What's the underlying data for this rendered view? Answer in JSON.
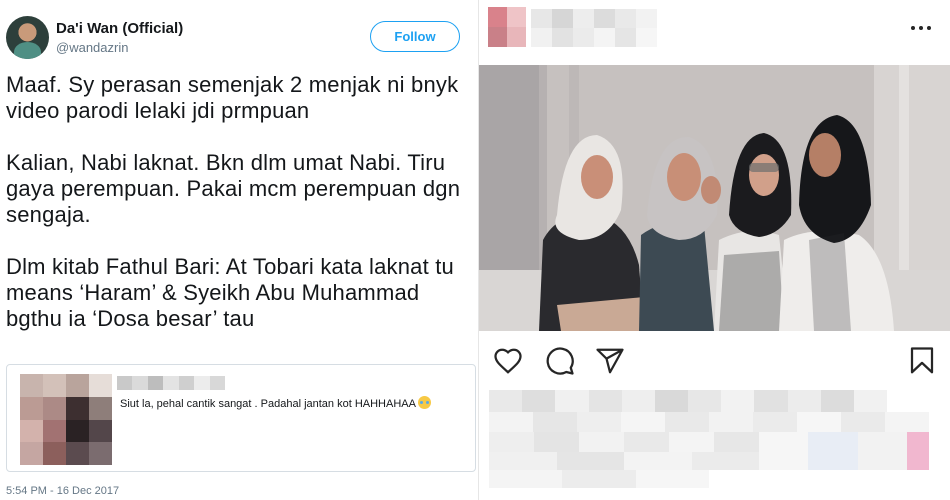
{
  "tweet": {
    "author_name": "Da'i Wan (Official)",
    "author_handle": "@wandazrin",
    "follow_label": "Follow",
    "body": "Maaf. Sy perasan semenjak 2 menjak ni bnyk\nvideo parodi lelaki jdi prmpuan\n\nKalian, Nabi laknat. Bkn dlm umat Nabi. Tiru\ngaya perempuan. Pakai mcm perempuan dgn\nsengaja.\n\nDlm kitab Fathul Bari: At Tobari kata laknat tu\nmeans ‘Haram’ & Syeikh Abu Muhammad\nbgthu ia ‘Dosa besar’ tau",
    "quoted": {
      "text": "Siut la, pehal cantik sangat . Padahal jantan kot HAHHAHAA",
      "emoji_icon": "laughing-tears-emoji"
    },
    "timestamp": "5:54 PM - 16 Dec 2017",
    "colors": {
      "accent": "#1da1f2",
      "text": "#14171a",
      "muted": "#657786"
    }
  },
  "instagram": {
    "icons": {
      "more": "more-horizontal-icon",
      "like": "heart-icon",
      "comment": "comment-icon",
      "share": "share-icon",
      "save": "bookmark-icon"
    }
  }
}
